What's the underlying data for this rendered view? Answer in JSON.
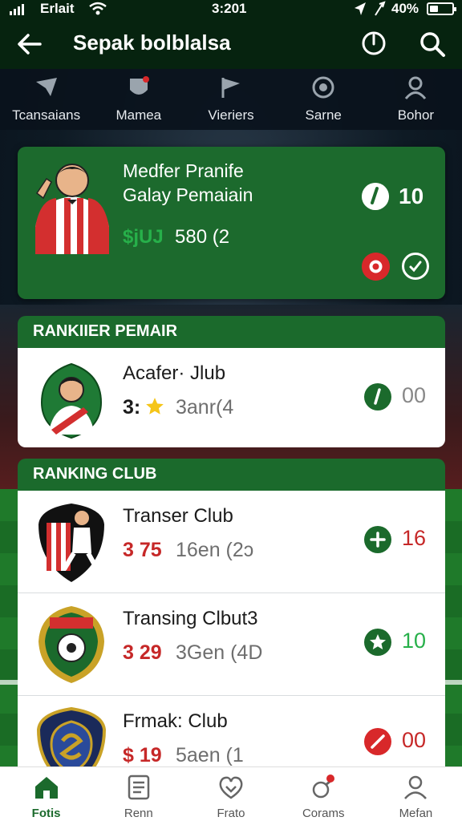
{
  "status_bar": {
    "carrier": "Erlait",
    "time": "3:201",
    "battery_text": "40%",
    "battery_level": 0.4
  },
  "header": {
    "title": "Sepak bolblalsa",
    "icons": [
      "back-arrow-icon",
      "power-icon",
      "search-icon"
    ]
  },
  "categories": [
    {
      "label": "Tcansaians",
      "icon": "paper-plane-icon"
    },
    {
      "label": "Mamea",
      "icon": "shield-badge-icon"
    },
    {
      "label": "Vieriers",
      "icon": "flag-icon"
    },
    {
      "label": "Sarne",
      "icon": "ball-icon"
    },
    {
      "label": "Bohor",
      "icon": "person-icon"
    }
  ],
  "featured": {
    "name": "Medfer Pranife",
    "subtitle_a": "Galay",
    "subtitle_b": "Pemaiain",
    "stat_a": "$jUJ",
    "stat_b": "580 (2",
    "score": "10"
  },
  "players_section": {
    "title": "RANKIIER PEMAIR",
    "row": {
      "name": "Acafer· Jlub",
      "num": "3:",
      "sub": "3anr(4",
      "value": "00"
    }
  },
  "clubs_section": {
    "title": "RANKING CLUB",
    "rows": [
      {
        "name": "Transer Club",
        "num": "3 75",
        "sub": "16en (2ↄ",
        "value": "16"
      },
      {
        "name": "Transing Clbut3",
        "num": "3 29",
        "sub": "3Gen (4D",
        "value": "10"
      },
      {
        "name": "Frmak: Club",
        "num": "$ 19",
        "sub": "5aen (1",
        "value": "00"
      }
    ]
  },
  "bottom_nav": [
    {
      "label": "Fotis",
      "icon": "home-icon",
      "active": true
    },
    {
      "label": "Renn",
      "icon": "list-card-icon",
      "active": false
    },
    {
      "label": "Frato",
      "icon": "heart-badge-icon",
      "active": false
    },
    {
      "label": "Corams",
      "icon": "whistle-icon",
      "active": false
    },
    {
      "label": "Mefan",
      "icon": "user-icon",
      "active": false
    }
  ],
  "colors": {
    "primary_green": "#1b6a2c",
    "dark_green": "#06230f",
    "accent_red": "#c62828",
    "accent_green": "#27b04a"
  }
}
